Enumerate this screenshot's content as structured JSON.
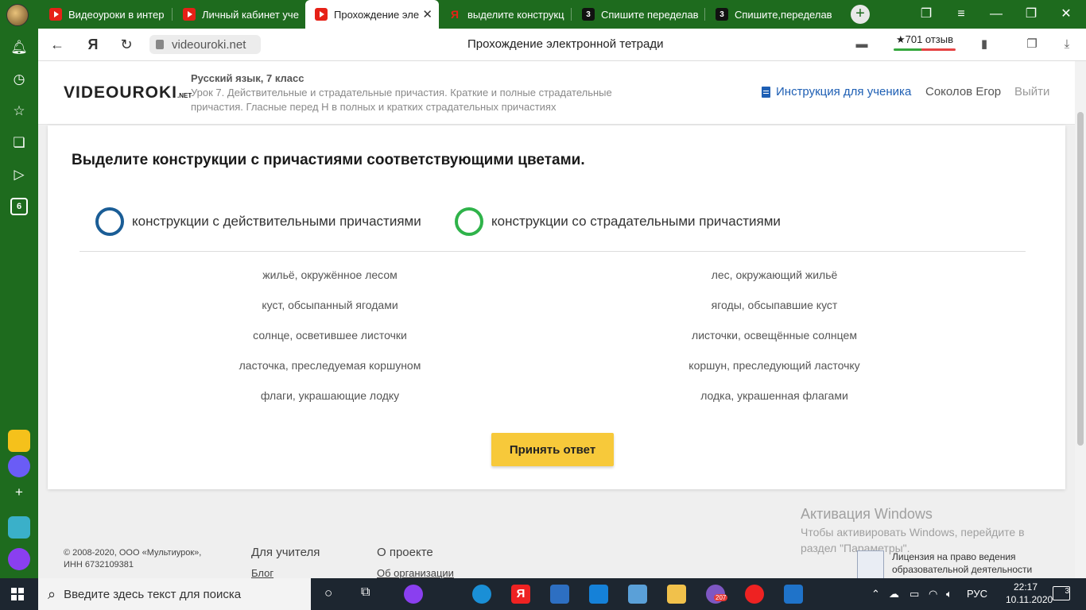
{
  "browser": {
    "tabs": [
      {
        "title": "Видеоуроки в интер",
        "icon": "youtube-icon"
      },
      {
        "title": "Личный кабинет уче",
        "icon": "youtube-icon"
      },
      {
        "title": "Прохождение эле",
        "icon": "videouroki-icon",
        "active": true
      },
      {
        "title": "выделите конструкц",
        "icon": "yandex-icon"
      },
      {
        "title": "Спишите переделав",
        "icon": "znanija-icon"
      },
      {
        "title": "Спишите,переделав",
        "icon": "znanija-icon"
      }
    ],
    "url": "videouroki.net",
    "page_title": "Прохождение электронной тетради",
    "reviews": "★701 отзыв",
    "sidebar_badge": "6",
    "close_glyph": "✕"
  },
  "site": {
    "logo_main": "VIDEOUROKI",
    "logo_suffix": ".NET",
    "course": "Русский язык, 7 класс",
    "lesson": "Урок 7. Действительные и страдательные причастия. Краткие и полные страдательные причастия. Гласные перед Н в полных и кратких страдательных причастиях",
    "instructions_link": "Инструкция для ученика",
    "user": "Соколов Егор",
    "logout": "Выйти"
  },
  "task": {
    "instruction": "Выделите конструкции с причастиями соответствующими цветами.",
    "legend": [
      {
        "label": "конструкции с действительными причастиями",
        "color": "#1a5d96"
      },
      {
        "label": "конструкции со страдательными причастиями",
        "color": "#2fb34a"
      }
    ],
    "left_phrases": [
      "жильё, окружённое лесом",
      "куст, обсыпанный ягодами",
      "солнце, осветившее листочки",
      "ласточка, преследуемая коршуном",
      "флаги, украшающие лодку"
    ],
    "right_phrases": [
      "лес, окружающий жильё",
      "ягоды, обсыпавшие куст",
      "листочки, освещённые солнцем",
      "коршун, преследующий ласточку",
      "лодка, украшенная флагами"
    ],
    "submit_label": "Принять ответ"
  },
  "footer": {
    "copyright": "© 2008-2020, ООО «Мультиурок», ИНН 6732109381",
    "teacher_head": "Для учителя",
    "teacher_link": "Блог",
    "about_head": "О проекте",
    "about_link": "Об организации",
    "license_text": "Лицензия на право ведения образовательной деятельности"
  },
  "windows": {
    "activation_title": "Активация Windows",
    "activation_text": "Чтобы активировать Windows, перейдите в раздел \"Параметры\".",
    "search_placeholder": "Введите здесь текст для поиска",
    "viber_badge": "207",
    "language": "РУС",
    "time": "22:17",
    "date": "10.11.2020",
    "notifications": "3"
  },
  "colors": {
    "browser_green": "#1e6b1e",
    "accent_yellow": "#f7c93a",
    "link_blue": "#1e5fb4"
  }
}
